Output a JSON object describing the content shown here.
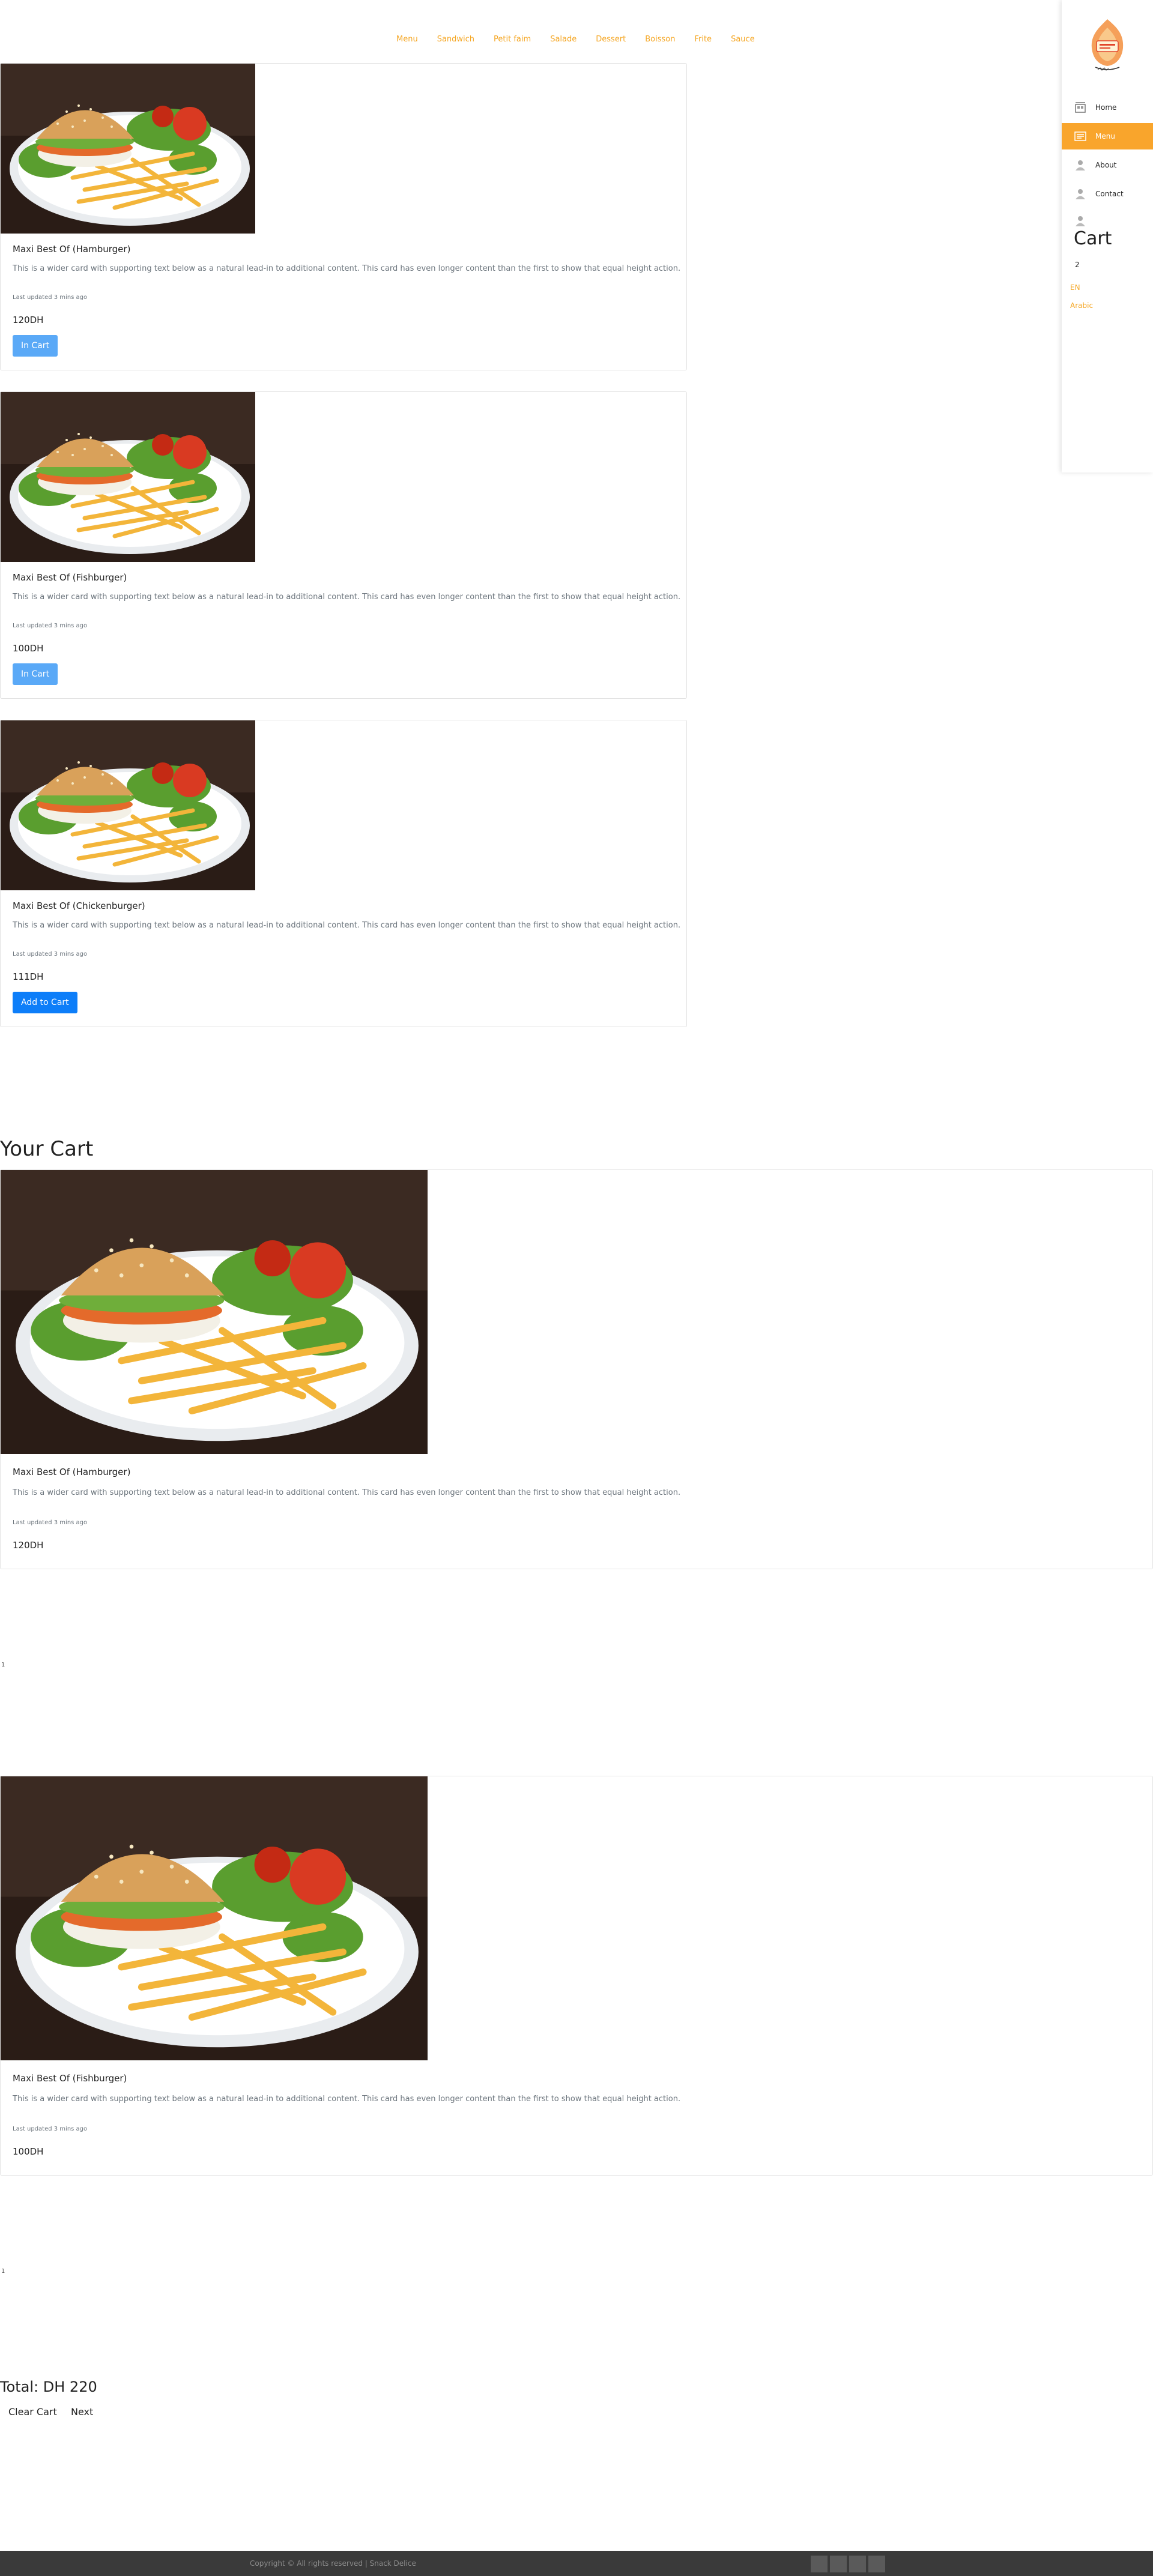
{
  "nav": {
    "items": [
      "Menu",
      "Sandwich",
      "Petit faim",
      "Salade",
      "Dessert",
      "Boisson",
      "Frite",
      "Sauce"
    ]
  },
  "sidebar": {
    "items": [
      {
        "label": "Home",
        "icon": "home-icon"
      },
      {
        "label": "Menu",
        "icon": "menu-icon",
        "active": true
      },
      {
        "label": "About",
        "icon": "user-icon"
      },
      {
        "label": "Contact",
        "icon": "user-icon"
      }
    ],
    "cart_title": "Cart",
    "cart_count": "2",
    "lang_en": "EN",
    "lang_ar": "Arabic"
  },
  "products": [
    {
      "title": "Maxi Best Of (Hamburger)",
      "text": "This is a wider card with supporting text below as a natural lead-in to additional content. This card has even longer content than the first to show that equal height action.",
      "updated": "Last updated 3 mins ago",
      "price": "120DH",
      "button": "In Cart"
    },
    {
      "title": "Maxi Best Of (Fishburger)",
      "text": "This is a wider card with supporting text below as a natural lead-in to additional content. This card has even longer content than the first to show that equal height action.",
      "updated": "Last updated 3 mins ago",
      "price": "100DH",
      "button": "In Cart"
    },
    {
      "title": "Maxi Best Of (Chickenburger)",
      "text": "This is a wider card with supporting text below as a natural lead-in to additional content. This card has even longer content than the first to show that equal height action.",
      "updated": "Last updated 3 mins ago",
      "price": "111DH",
      "button": "Add to Cart"
    }
  ],
  "cart": {
    "title": "Your Cart",
    "items": [
      {
        "title": "Maxi Best Of (Hamburger)",
        "text": "This is a wider card with supporting text below as a natural lead-in to additional content. This card has even longer content than the first to show that equal height action.",
        "updated": "Last updated 3 mins ago",
        "price": "120DH",
        "qty": "1"
      },
      {
        "title": "Maxi Best Of (Fishburger)",
        "text": "This is a wider card with supporting text below as a natural lead-in to additional content. This card has even longer content than the first to show that equal height action.",
        "updated": "Last updated 3 mins ago",
        "price": "100DH",
        "qty": "1"
      }
    ],
    "total": "Total: DH 220",
    "clear_label": "Clear Cart",
    "next_label": "Next"
  },
  "footer": {
    "copyright": "Copyright © All rights reserved | Snack Delice"
  },
  "colors": {
    "accent": "#f9a52c",
    "button_blue": "#0d7ef9",
    "button_incart": "#5aa9f7",
    "footer_bg": "#3a3a3a"
  }
}
